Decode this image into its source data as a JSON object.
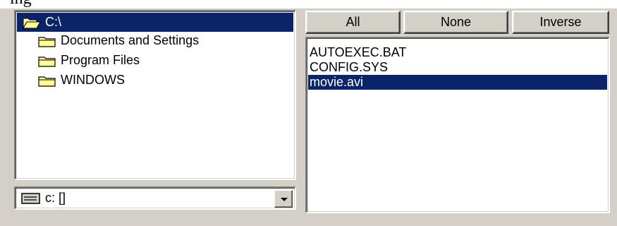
{
  "tree": {
    "root": {
      "label": "C:\\",
      "icon": "open-folder-icon"
    },
    "children": [
      {
        "label": "Documents and Settings",
        "icon": "folder-icon"
      },
      {
        "label": "Program Files",
        "icon": "folder-icon"
      },
      {
        "label": "WINDOWS",
        "icon": "folder-icon"
      }
    ]
  },
  "drive_select": {
    "value": "c: []",
    "icon": "drive-icon"
  },
  "buttons": {
    "all_label": "All",
    "none_label": "None",
    "inverse_label": "Inverse"
  },
  "files": [
    {
      "name": "AUTOEXEC.BAT",
      "selected": false
    },
    {
      "name": "CONFIG.SYS",
      "selected": false
    },
    {
      "name": "movie.avi",
      "selected": true
    }
  ],
  "colors": {
    "face": "#d4d0c8",
    "selection": "#0a246a",
    "folder": "#ffff99"
  }
}
